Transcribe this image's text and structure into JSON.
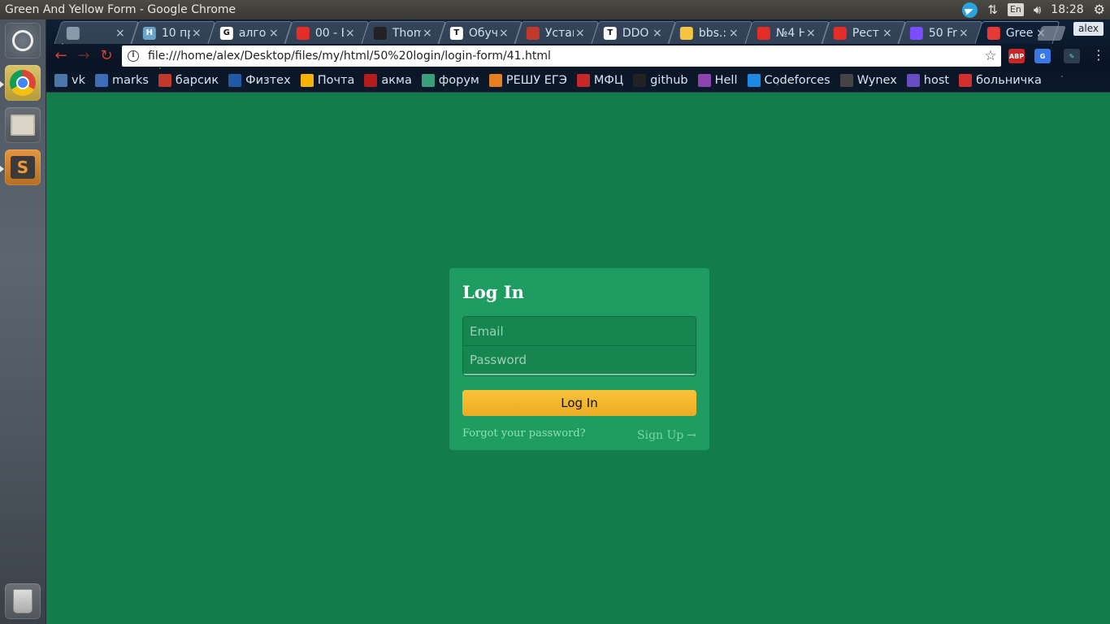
{
  "system": {
    "window_title": "Green And Yellow Form - Google Chrome",
    "language": "En",
    "time": "18:28",
    "user": "alex"
  },
  "browser": {
    "tabs": [
      {
        "label": "",
        "favicon": "speaker-icon",
        "color": "#8899aa"
      },
      {
        "label": "10 пр",
        "favicon": "H",
        "color": "#6aa4c8"
      },
      {
        "label": "алго",
        "favicon": "G",
        "color": "#ffffff"
      },
      {
        "label": "00 - В",
        "favicon": "youtube-icon",
        "color": "#e52d27"
      },
      {
        "label": "Thom",
        "favicon": "github-icon",
        "color": "#222222"
      },
      {
        "label": "Обуч",
        "favicon": "T",
        "color": "#ffffff"
      },
      {
        "label": "Устан",
        "favicon": "rose-icon",
        "color": "#c0392b"
      },
      {
        "label": "DDO",
        "favicon": "T",
        "color": "#ffffff"
      },
      {
        "label": "bbs.:",
        "favicon": "note-icon",
        "color": "#f5c542"
      },
      {
        "label": "№4 Н",
        "favicon": "youtube-icon",
        "color": "#e52d27"
      },
      {
        "label": "Рест",
        "favicon": "youtube-icon",
        "color": "#e52d27"
      },
      {
        "label": "50 Fr",
        "favicon": "codepen-icon",
        "color": "#7c4dff"
      },
      {
        "label": "Gree",
        "favicon": "file-icon",
        "color": "#e53935"
      }
    ],
    "url": "file:///home/alex/Desktop/files/my/html/50%20login/login-form/41.html",
    "extensions": [
      "ABP",
      "translate",
      "picker"
    ],
    "bookmarks": [
      {
        "label": "vk",
        "color": "#4a76a8"
      },
      {
        "label": "marks",
        "color": "#3f6cb5"
      },
      {
        "label": "барсик",
        "color": "#c0392b"
      },
      {
        "label": "Физтех",
        "color": "#1e5aa8"
      },
      {
        "label": "Почта",
        "color": "#f4b400"
      },
      {
        "label": "акма",
        "color": "#b71c1c"
      },
      {
        "label": "форум",
        "color": "#3aa07a"
      },
      {
        "label": "РЕШУ ЕГЭ",
        "color": "#e67e22"
      },
      {
        "label": "МФЦ",
        "color": "#c62828"
      },
      {
        "label": "github",
        "color": "#222222"
      },
      {
        "label": "Hell",
        "color": "#8e44ad"
      },
      {
        "label": "Codeforces",
        "color": "#1e88e5"
      },
      {
        "label": "Wynex",
        "color": "#444444"
      },
      {
        "label": "host",
        "color": "#6a4cc2"
      },
      {
        "label": "больничка",
        "color": "#d32f2f"
      }
    ]
  },
  "login": {
    "title": "Log In",
    "email_placeholder": "Email",
    "password_placeholder": "Password",
    "submit_label": "Log In",
    "forgot_label": "Forgot your password?",
    "signup_label": "Sign Up",
    "signup_arrow": "→"
  },
  "colors": {
    "page_background": "#127d4b",
    "form_background": "#1f9c62",
    "button": "#f3b630"
  }
}
